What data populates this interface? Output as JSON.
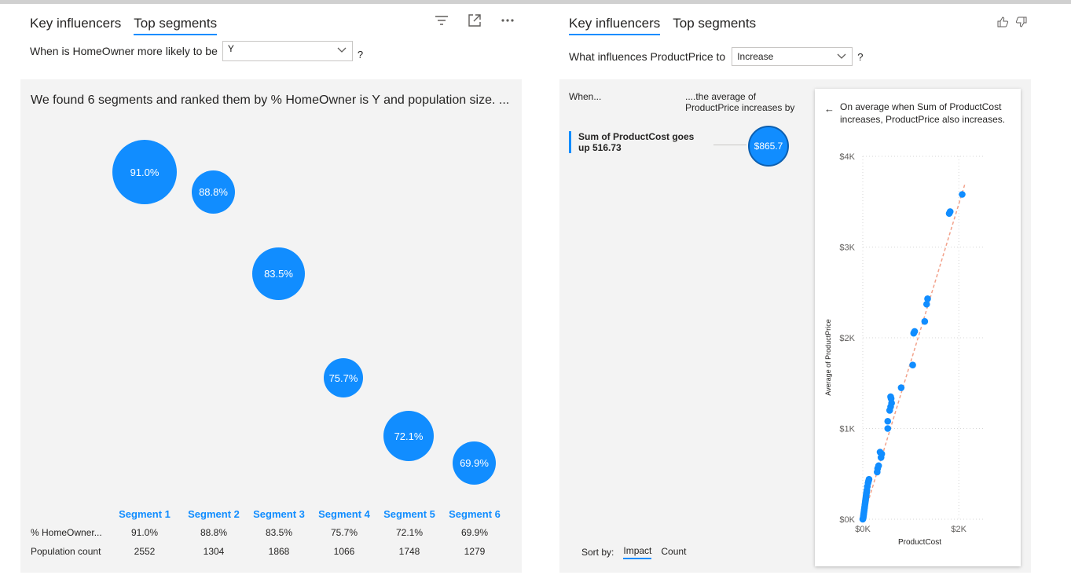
{
  "left": {
    "tabs": [
      {
        "label": "Key influencers",
        "active": false
      },
      {
        "label": "Top segments",
        "active": true
      }
    ],
    "question": "When is HomeOwner more likely to be",
    "dropdown_value": "Y",
    "question_mark": "?",
    "found_text": "We found 6 segments and ranked them by % HomeOwner is Y and population size. ...",
    "bubbles": [
      "91.0%",
      "88.8%",
      "83.5%",
      "75.7%",
      "72.1%",
      "69.9%"
    ],
    "segments": [
      "Segment 1",
      "Segment 2",
      "Segment 3",
      "Segment 4",
      "Segment 5",
      "Segment 6"
    ],
    "row_labels": {
      "pct": "% HomeOwner...",
      "pop": "Population count"
    },
    "pct_values": [
      "91.0%",
      "88.8%",
      "83.5%",
      "75.7%",
      "72.1%",
      "69.9%"
    ],
    "pop_values": [
      "2552",
      "1304",
      "1868",
      "1066",
      "1748",
      "1279"
    ],
    "icons": [
      "filter-icon",
      "focus-mode-icon",
      "more-options-icon"
    ]
  },
  "right": {
    "tabs": [
      {
        "label": "Key influencers",
        "active": true
      },
      {
        "label": "Top segments",
        "active": false
      }
    ],
    "question": "What influences ProductPrice to",
    "dropdown_value": "Increase",
    "question_mark": "?",
    "when_label": "When...",
    "avg_label": "....the average of ProductPrice increases by",
    "influencer_text": "Sum of ProductCost goes up 516.73",
    "impact_value": "$865.7",
    "sort_label": "Sort by:",
    "sort_options": [
      {
        "label": "Impact",
        "active": true
      },
      {
        "label": "Count",
        "active": false
      }
    ],
    "detail_description": "On average when Sum of ProductCost increases, ProductPrice also increases.",
    "icons": [
      "thumbs-up-icon",
      "thumbs-down-icon",
      "back-arrow-icon"
    ]
  },
  "chart_data": {
    "type": "scatter",
    "xlabel": "ProductCost",
    "ylabel": "Average of ProductPrice",
    "x_ticks": [
      "$0K",
      "$2K"
    ],
    "y_ticks": [
      "$0K",
      "$1K",
      "$2K",
      "$3K",
      "$4K"
    ],
    "xlim": [
      0,
      2700
    ],
    "ylim": [
      0,
      4000
    ],
    "grid": true,
    "trendline": {
      "x": [
        0,
        2130
      ],
      "y": [
        0,
        3700
      ]
    },
    "points": [
      [
        0,
        0
      ],
      [
        10,
        20
      ],
      [
        15,
        40
      ],
      [
        20,
        60
      ],
      [
        25,
        80
      ],
      [
        30,
        100
      ],
      [
        35,
        120
      ],
      [
        40,
        140
      ],
      [
        45,
        160
      ],
      [
        50,
        180
      ],
      [
        55,
        200
      ],
      [
        60,
        220
      ],
      [
        65,
        240
      ],
      [
        70,
        260
      ],
      [
        75,
        280
      ],
      [
        80,
        300
      ],
      [
        85,
        320
      ],
      [
        95,
        360
      ],
      [
        110,
        400
      ],
      [
        120,
        420
      ],
      [
        130,
        440
      ],
      [
        300,
        520
      ],
      [
        310,
        560
      ],
      [
        330,
        590
      ],
      [
        380,
        680
      ],
      [
        395,
        720
      ],
      [
        360,
        740
      ],
      [
        520,
        1000
      ],
      [
        520,
        1080
      ],
      [
        560,
        1200
      ],
      [
        580,
        1240
      ],
      [
        600,
        1280
      ],
      [
        590,
        1330
      ],
      [
        580,
        1350
      ],
      [
        800,
        1450
      ],
      [
        1040,
        1700
      ],
      [
        1060,
        2050
      ],
      [
        1080,
        2070
      ],
      [
        1290,
        2180
      ],
      [
        1330,
        2370
      ],
      [
        1350,
        2430
      ],
      [
        1800,
        3370
      ],
      [
        1820,
        3390
      ],
      [
        2070,
        3580
      ]
    ],
    "point_color": "#118dff",
    "trend_color": "#f2a18a"
  }
}
